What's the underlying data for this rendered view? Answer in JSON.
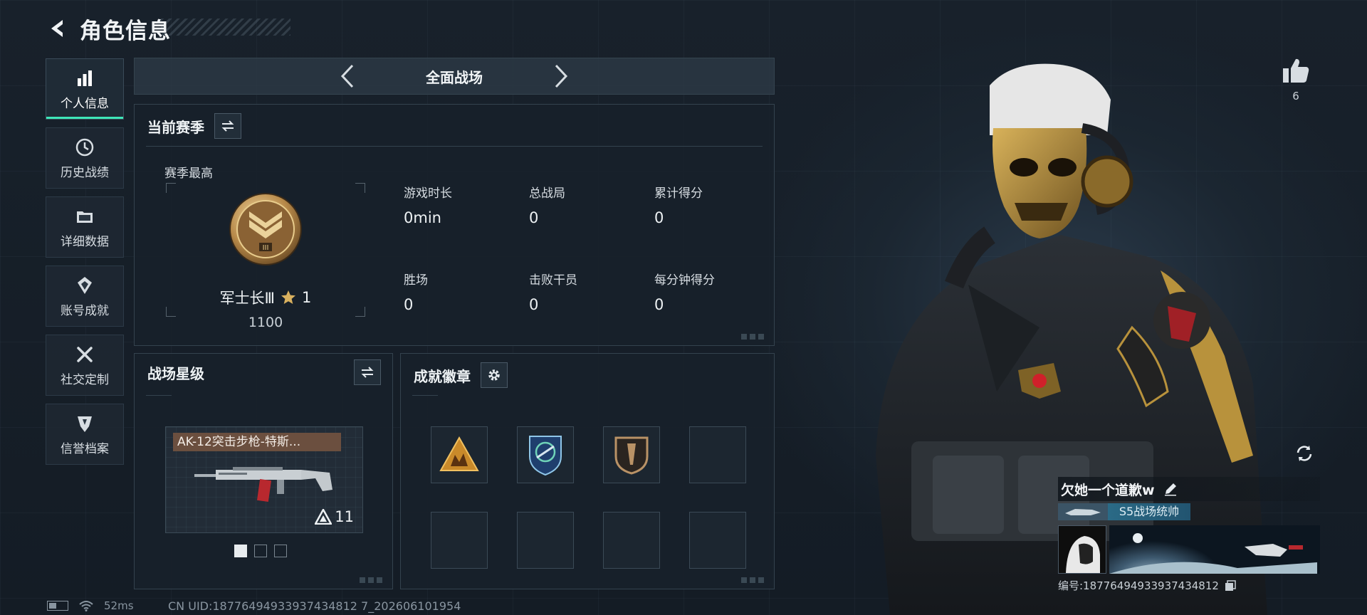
{
  "header": {
    "title": "角色信息"
  },
  "nav": {
    "items": [
      {
        "label": "个人信息",
        "icon": "bar-chart-icon",
        "active": true
      },
      {
        "label": "历史战绩",
        "icon": "history-icon"
      },
      {
        "label": "详细数据",
        "icon": "folder-icon"
      },
      {
        "label": "账号成就",
        "icon": "achievement-icon"
      },
      {
        "label": "社交定制",
        "icon": "wrench-icon"
      },
      {
        "label": "信誉档案",
        "icon": "shield-icon"
      }
    ]
  },
  "mode": {
    "title": "全面战场"
  },
  "season": {
    "title": "当前赛季",
    "best_label": "赛季最高",
    "rank_name": "军士长Ⅲ",
    "rank_stars": "1",
    "rank_score": "1100",
    "stats": [
      {
        "label": "游戏时长",
        "value": "0min"
      },
      {
        "label": "总战局",
        "value": "0"
      },
      {
        "label": "累计得分",
        "value": "0"
      },
      {
        "label": "胜场",
        "value": "0"
      },
      {
        "label": "击败干员",
        "value": "0"
      },
      {
        "label": "每分钟得分",
        "value": "0"
      }
    ]
  },
  "star_level": {
    "title": "战场星级",
    "weapon_name": "AK-12突击步枪-特斯...",
    "weapon_level": "11"
  },
  "badges": {
    "title": "成就徽章"
  },
  "likes": {
    "count": "6"
  },
  "profile": {
    "player_name": "欠她一个道歉w",
    "title_badge": "S5战场统帅",
    "id_text": "编号:18776494933937434812"
  },
  "footer": {
    "ping": "52ms",
    "uid": "CN UID:18776494933937434812 7_202606101954"
  },
  "colors": {
    "accent": "#3ee6b8",
    "gold": "#c9a45a",
    "nav_bg": "#1e2832"
  }
}
